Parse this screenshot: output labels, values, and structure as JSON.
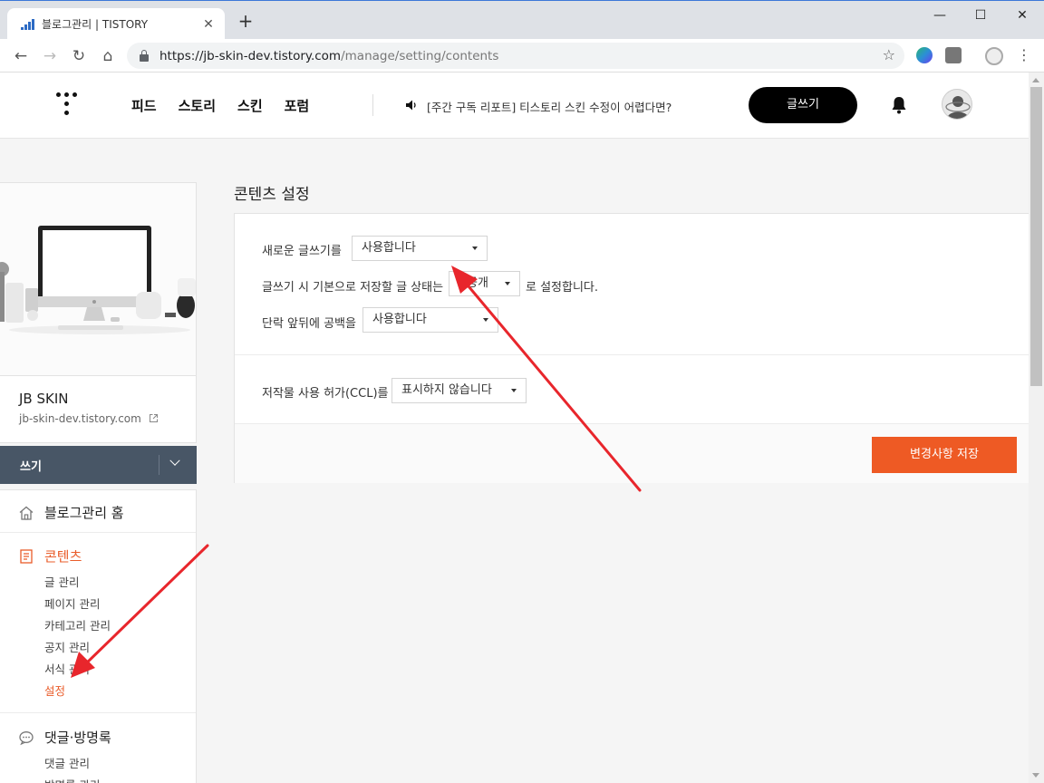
{
  "browser": {
    "tab_title": "블로그관리 | TISTORY",
    "close_glyph": "✕",
    "new_tab_glyph": "+",
    "url_host": "https://jb-skin-dev.tistory.com",
    "url_path": "/manage/setting/contents",
    "window_controls": {
      "minimize": "—",
      "maximize": "☐",
      "close": "✕"
    }
  },
  "header": {
    "nav": [
      "피드",
      "스토리",
      "스킨",
      "포럼"
    ],
    "notice": "[주간 구독 리포트] 티스토리 스킨 수정이 어렵다면?",
    "write_button": "글쓰기"
  },
  "sidebar": {
    "blog_name": "JB SKIN",
    "blog_url": "jb-skin-dev.tistory.com",
    "write_bar": "쓰기",
    "home": "블로그관리 홈",
    "contents": {
      "label": "콘텐츠",
      "items": [
        "글 관리",
        "페이지 관리",
        "카테고리 관리",
        "공지 관리",
        "서식 관리",
        "설정"
      ],
      "active_index": 5
    },
    "comments": {
      "label": "댓글·방명록",
      "items": [
        "댓글 관리",
        "방명록 관리"
      ]
    }
  },
  "main": {
    "title": "콘텐츠 설정",
    "new_editor": {
      "label": "새로운 글쓰기를",
      "value": "사용합니다"
    },
    "default_status": {
      "label": "글쓰기 시 기본으로 저장할 글 상태는",
      "value": "공개",
      "suffix": "로 설정합니다."
    },
    "paragraph_spacing": {
      "label": "단락 앞뒤에 공백을",
      "value": "사용합니다"
    },
    "ccl": {
      "label": "저작물 사용 허가(CCL)를",
      "value": "표시하지 않습니다"
    },
    "save_button": "변경사항 저장"
  },
  "colors": {
    "accent": "#ee5a24",
    "active_menu": "#e95c2a",
    "write_bar": "#485666",
    "arrow": "#e8262c"
  }
}
